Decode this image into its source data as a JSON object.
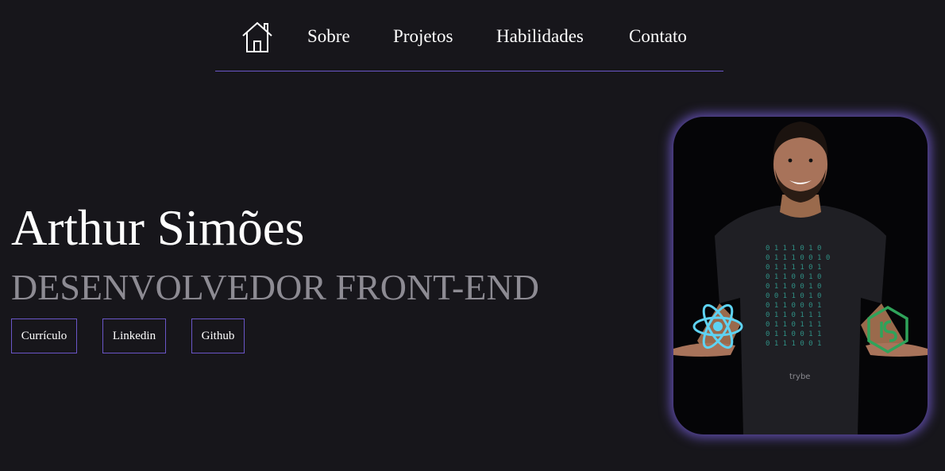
{
  "nav": {
    "home_icon": "home-icon",
    "links": [
      {
        "label": "Sobre"
      },
      {
        "label": "Projetos"
      },
      {
        "label": "Habilidades"
      },
      {
        "label": "Contato"
      }
    ]
  },
  "hero": {
    "name": "Arthur Simões",
    "role": "DESENVOLVEDOR FRONT-END",
    "buttons": [
      {
        "label": "Currículo"
      },
      {
        "label": "Linkedin"
      },
      {
        "label": "Github"
      }
    ]
  },
  "photo": {
    "shirt_brand": "trybe",
    "left_icon": "react-icon",
    "right_icon": "nodejs-icon"
  },
  "colors": {
    "background": "#17161b",
    "accent": "#6a56c8",
    "muted_text": "#8d8b93",
    "react": "#5ed3f3",
    "node": "#2fa35a"
  }
}
